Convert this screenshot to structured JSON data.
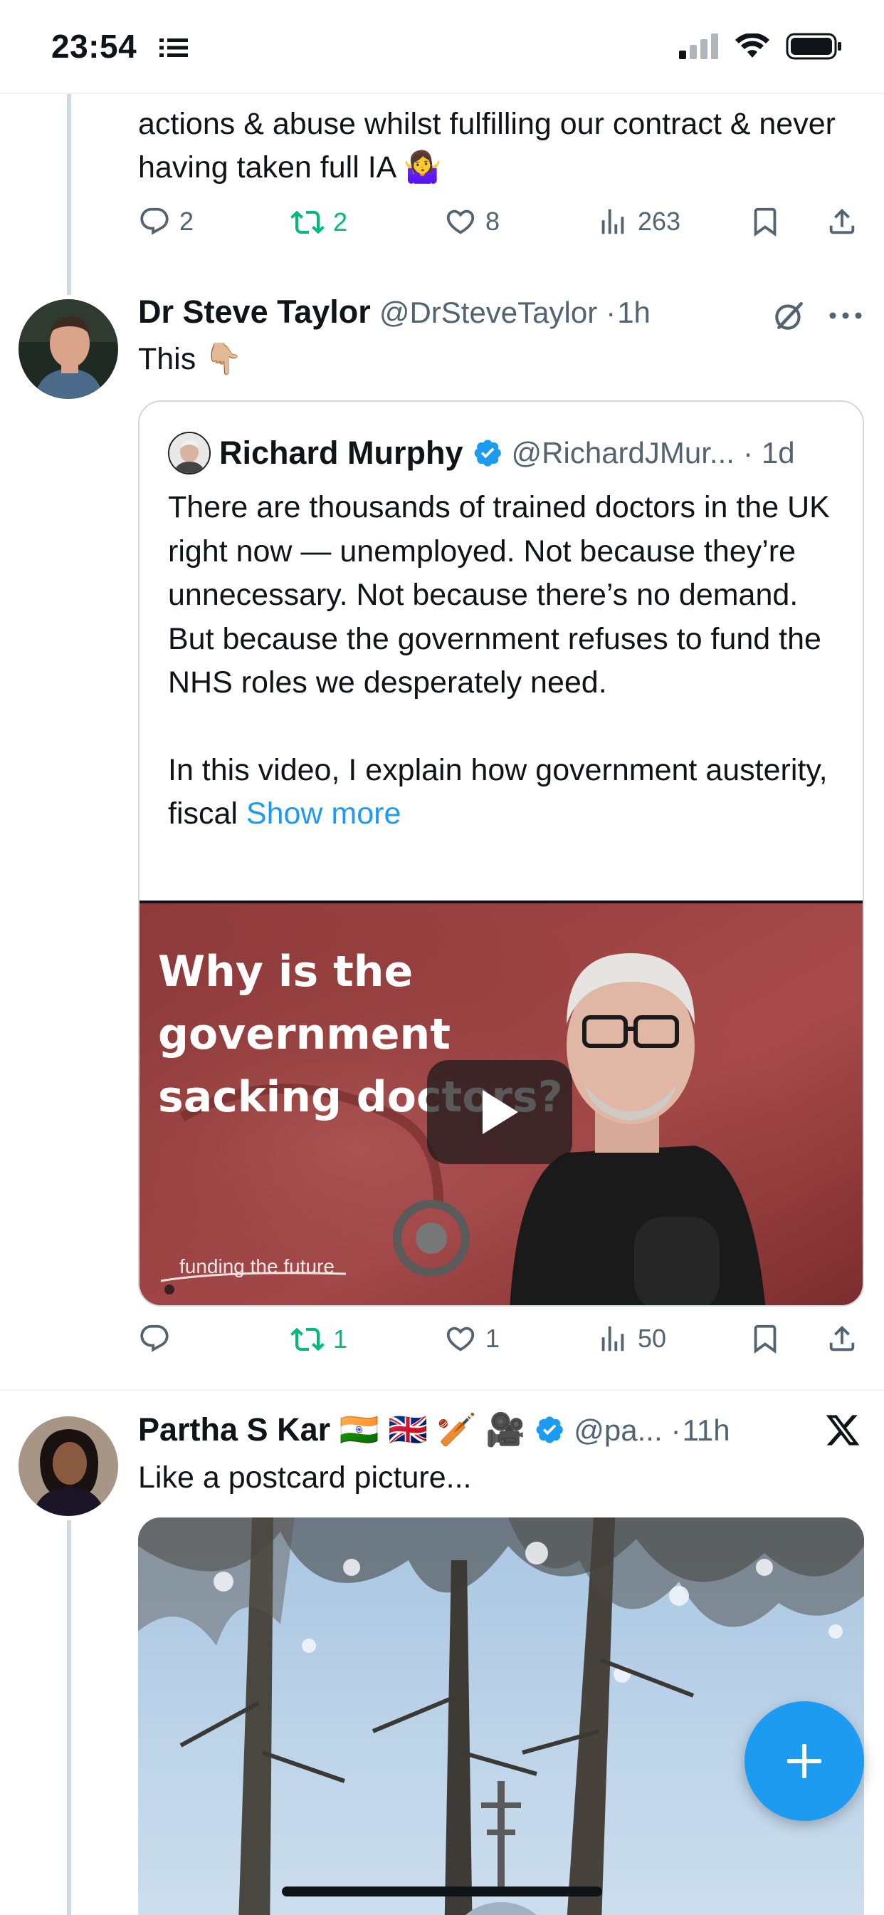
{
  "status_bar": {
    "time": "23:54"
  },
  "colors": {
    "accent": "#1d9bf0",
    "retweet": "#00ba7c",
    "muted": "#536471",
    "text": "#0f1419"
  },
  "tweet_top": {
    "text_partial": "actions & abuse whilst fulfilling our contract & never having taken full IA 🤷‍♀️",
    "replies": "2",
    "retweets": "2",
    "likes": "8",
    "views": "263"
  },
  "tweet_steve": {
    "name": "Dr Steve Taylor",
    "handle": "@DrSteveTaylor",
    "separator": "·",
    "time": "1h",
    "text": "This 👇🏼",
    "quote": {
      "name": "Richard Murphy",
      "handle": "@RichardJMur...",
      "separator": "·",
      "time": "1d",
      "paragraph1": "There are thousands of trained doctors in the UK right now — unemployed. Not because they’re unnecessary. Not because there’s no demand. But because the government refuses to fund the NHS roles we desperately need.",
      "paragraph2": "In this video, I explain how government austerity, fiscal",
      "show_more": "Show more",
      "video": {
        "title_line1": "Why is the",
        "title_line2": "government",
        "title_line3": "sacking doctors?",
        "footer": "funding the future"
      }
    },
    "actions": {
      "replies": "",
      "retweets": "1",
      "likes": "1",
      "views": "50"
    }
  },
  "tweet_partha": {
    "name": "Partha S Kar 🇮🇳 🇬🇧 🏏 🎥",
    "handle": "@pa...",
    "separator": "·",
    "time": "11h",
    "text": "Like a postcard picture..."
  },
  "icons": [
    "list-icon",
    "signal-icon",
    "wifi-icon",
    "battery-icon",
    "reply-icon",
    "retweet-icon",
    "like-icon",
    "views-icon",
    "bookmark-icon",
    "share-icon",
    "grok-icon",
    "more-icon",
    "verified-icon",
    "x-logo-icon",
    "play-icon",
    "compose-plus-icon"
  ]
}
